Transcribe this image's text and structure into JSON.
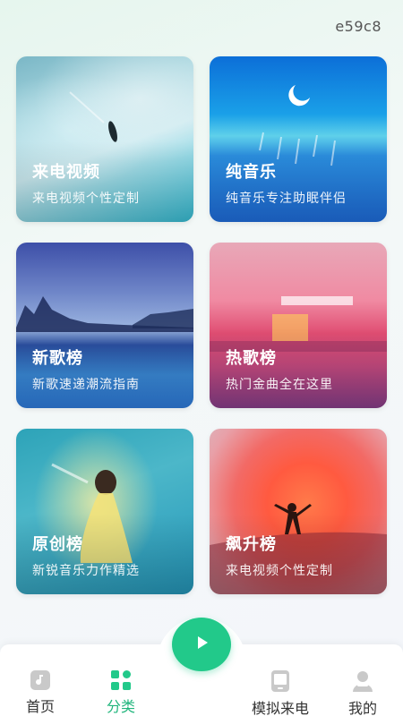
{
  "header": {
    "code": "e59c8"
  },
  "cards": [
    {
      "title": "来电视频",
      "subtitle": "来电视频个性定制"
    },
    {
      "title": "纯音乐",
      "subtitle": "纯音乐专注助眠伴侣"
    },
    {
      "title": "新歌榜",
      "subtitle": "新歌速递潮流指南"
    },
    {
      "title": "热歌榜",
      "subtitle": "热门金曲全在这里"
    },
    {
      "title": "原创榜",
      "subtitle": "新锐音乐力作精选"
    },
    {
      "title": "飙升榜",
      "subtitle": "来电视频个性定制"
    }
  ],
  "nav": {
    "items": [
      {
        "label": "首页",
        "icon": "music-note-icon"
      },
      {
        "label": "分类",
        "icon": "category-grid-icon",
        "active": true
      },
      {
        "label": "模拟来电",
        "icon": "phone-device-icon"
      },
      {
        "label": "我的",
        "icon": "user-icon"
      }
    ],
    "center_icon": "play-icon",
    "accent_color": "#22c98a"
  }
}
